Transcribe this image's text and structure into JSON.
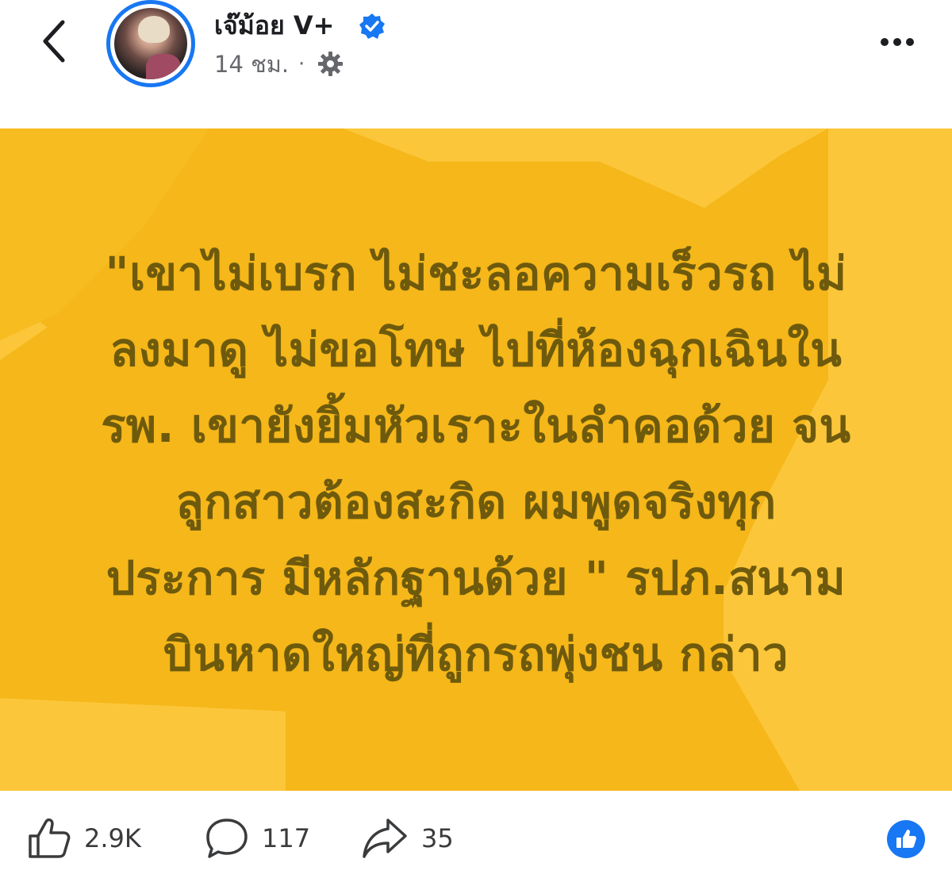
{
  "header": {
    "author_name": "เจ๊ม้อย V+",
    "timestamp": "14 ชม.",
    "separator": "·",
    "icons": {
      "back": "chevron-left-icon",
      "verified": "verified-badge-icon",
      "audience": "gear-icon",
      "more": "more-dots-icon"
    }
  },
  "post": {
    "background_color": "#fcc63a",
    "text_color": "#6e5a0d",
    "lines": [
      "\"เขาไม่เบรก ไม่ชะลอความเร็วรถ ไม่",
      "ลงมาดู ไม่ขอโทษ ไปที่ห้องฉุกเฉินใน",
      "รพ. เขายังยิ้มหัวเราะในลำคอด้วย จน",
      "ลูกสาวต้องสะกิด ผมพูดจริงทุก",
      "ประการ มีหลักฐานด้วย \" รปภ.สนาม",
      "บินหาดใหญ่ที่ถูกรถพุ่งชน กล่าว"
    ]
  },
  "actions": {
    "likes": "2.9K",
    "comments": "117",
    "shares": "35",
    "icons": {
      "like": "thumbs-up-icon",
      "comment": "comment-bubble-icon",
      "share": "share-arrow-icon",
      "reaction": "like-reaction-icon"
    }
  },
  "colors": {
    "accent": "#1877f2",
    "post_bg": "#fcc63a",
    "post_text": "#6e5a0d"
  }
}
